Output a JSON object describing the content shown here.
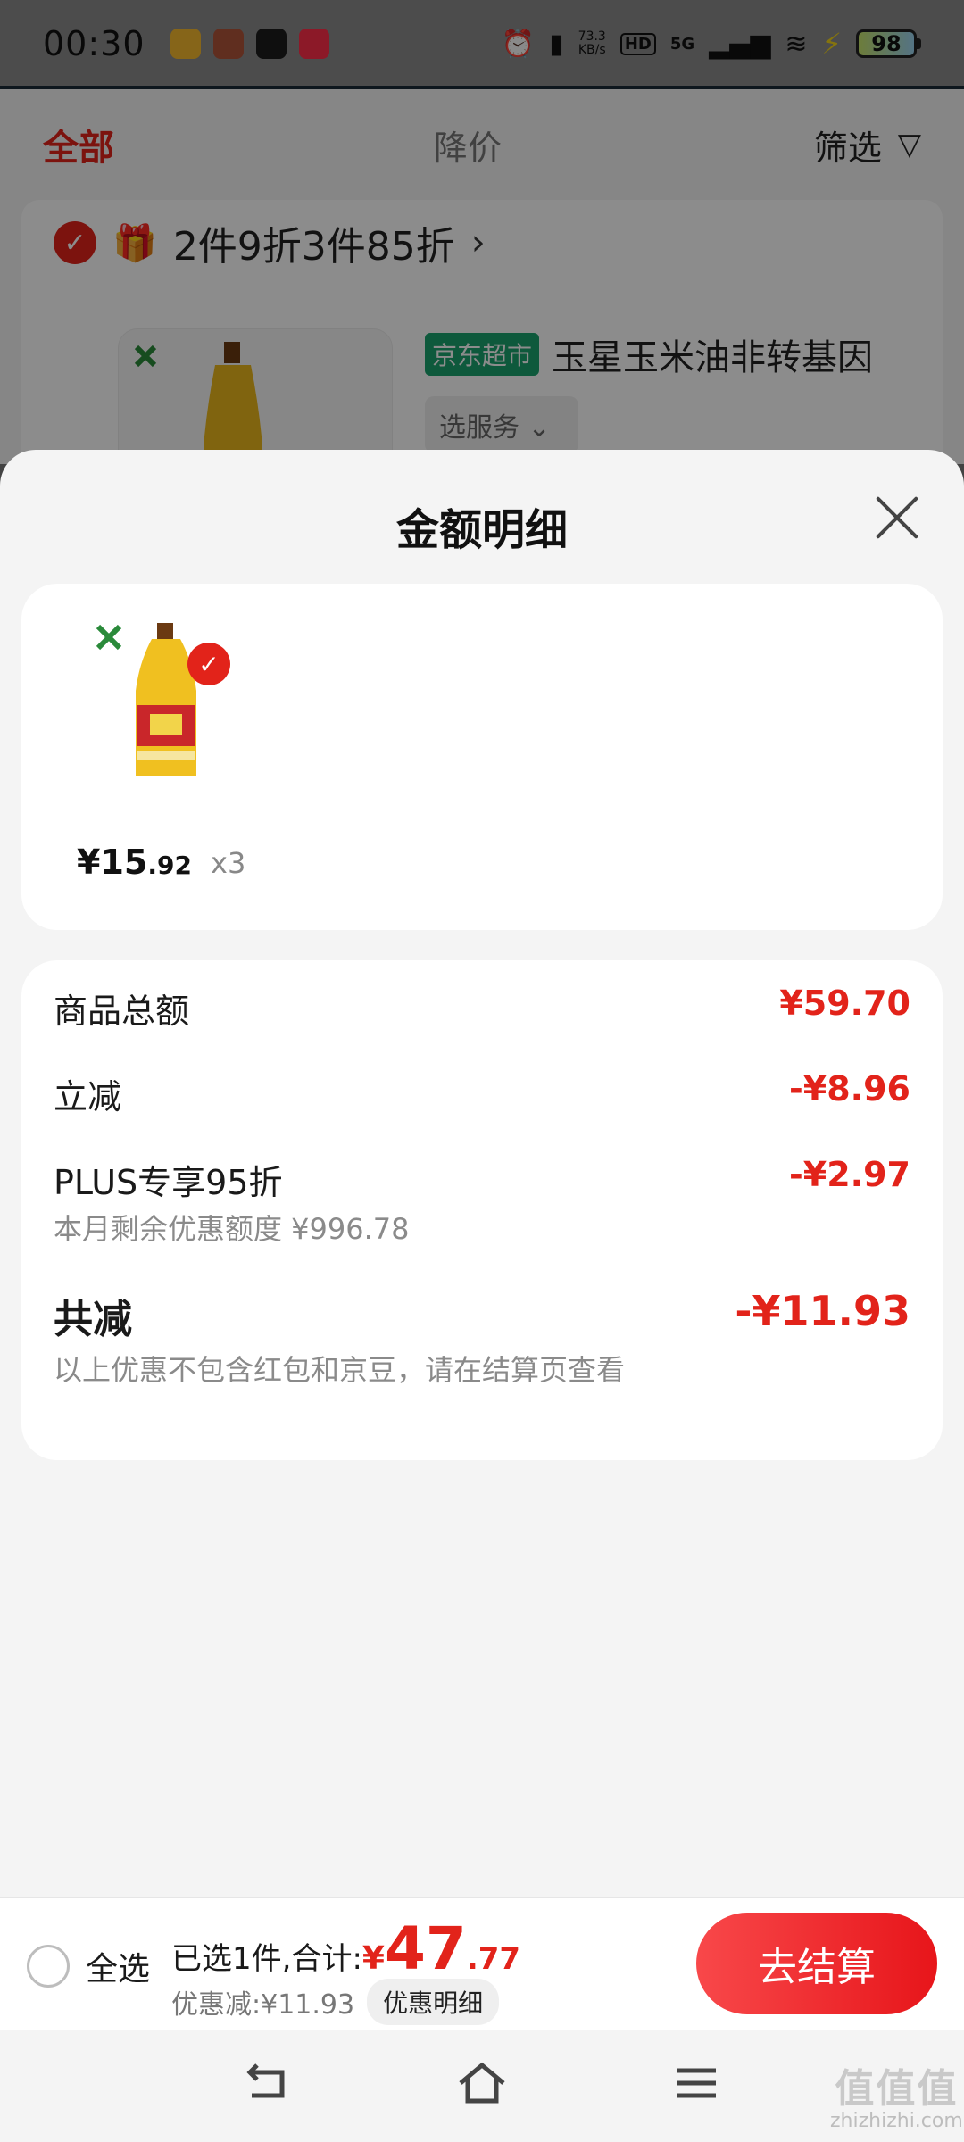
{
  "status_bar": {
    "time": "00:30",
    "net_speed_value": "73.3",
    "net_speed_unit": "KB/s",
    "hd": "HD",
    "network": "5G",
    "battery": "98"
  },
  "background": {
    "tabs": {
      "all": "全部",
      "price_drop": "降价",
      "filter": "筛选"
    },
    "promo": "2件9折3件85折",
    "promo_arrow": "›",
    "product_tag": "京东超市",
    "product_title": "玉星玉米油非转基因",
    "service_button": "选服务 ⌄"
  },
  "sheet": {
    "title": "金额明细",
    "item": {
      "price_symbol": "¥",
      "price_int": "15",
      "price_dec": ".92",
      "quantity": "x3"
    },
    "rows": {
      "goods_total_label": "商品总额",
      "goods_total_value": "¥59.70",
      "instant_off_label": "立减",
      "instant_off_value": "-¥8.96",
      "plus_label": "PLUS专享95折",
      "plus_value": "-¥2.97",
      "plus_sub": "本月剩余优惠额度 ¥996.78",
      "total_off_label": "共减",
      "total_off_value": "-¥11.93",
      "note": "以上优惠不包含红包和京豆，请在结算页查看"
    }
  },
  "checkout": {
    "select_all": "全选",
    "summary": "已选1件,合计:",
    "currency": "¥",
    "total_int": "47",
    "total_dec": ".77",
    "discount": "优惠减:¥11.93",
    "discount_detail": "优惠明细",
    "checkout_button": "去结算"
  },
  "watermark": {
    "main": "值值值",
    "domain": "zhizhizhi.com"
  },
  "colors": {
    "accent": "#e2231a",
    "jd_green": "#1aa36e",
    "sheet_bg": "#f4f4f4"
  }
}
